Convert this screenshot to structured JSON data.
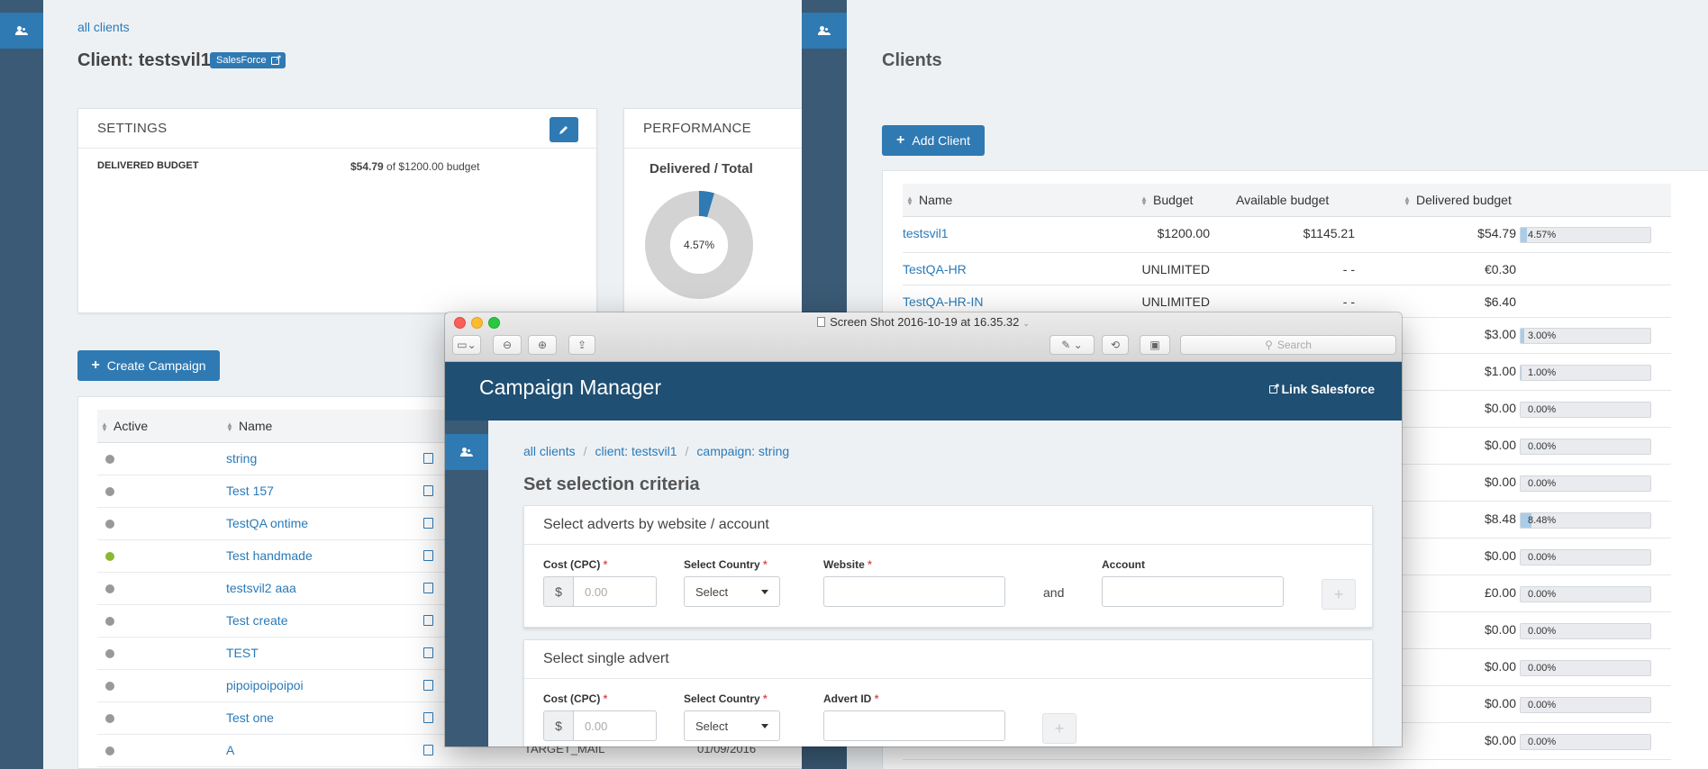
{
  "left_window": {
    "breadcrumb": "all clients",
    "title": "Client: testsvil1",
    "salesforce_badge": "SalesForce",
    "settings": {
      "heading": "SETTINGS",
      "delivered_budget_label": "DELIVERED BUDGET",
      "delivered_amount": "$54.79",
      "delivered_suffix": "of $1200.00 budget"
    },
    "performance": {
      "heading": "PERFORMANCE",
      "subtitle": "Delivered / Total",
      "percent_label": "4.57%",
      "fraction": 0.0457,
      "colors": {
        "delivered": "#2f7ab3",
        "remaining": "#d3d3d3"
      }
    },
    "create_campaign_label": "Create Campaign",
    "columns": {
      "active": "Active",
      "name": "Name"
    },
    "campaigns": [
      {
        "name": "string",
        "status_color": "#999999"
      },
      {
        "name": "Test 157",
        "status_color": "#999999"
      },
      {
        "name": "TestQA ontime",
        "status_color": "#999999"
      },
      {
        "name": "Test handmade",
        "status_color": "#8cb830"
      },
      {
        "name": "testsvil2 aaa",
        "status_color": "#999999"
      },
      {
        "name": "Test create",
        "status_color": "#999999"
      },
      {
        "name": "TEST",
        "status_color": "#999999"
      },
      {
        "name": "pipoipoipoipoi",
        "status_color": "#999999"
      },
      {
        "name": "Test one",
        "status_color": "#999999"
      },
      {
        "name": "A",
        "status_color": "#999999"
      }
    ],
    "partial_row": {
      "type": "TARGET_MAIL",
      "date": "01/09/2016"
    }
  },
  "right_window": {
    "title": "Clients",
    "add_client_label": "Add Client",
    "columns": {
      "name": "Name",
      "budget": "Budget",
      "available": "Available budget",
      "delivered": "Delivered budget"
    },
    "clients": [
      {
        "name": "testsvil1",
        "budget": "$1200.00",
        "available": "$1145.21",
        "delivered": "$54.79",
        "pct_label": "4.57%",
        "pct": 0.0457
      },
      {
        "name": "TestQA-HR",
        "budget": "UNLIMITED",
        "available": "- -",
        "delivered": "€0.30"
      },
      {
        "name": "TestQA-HR-IN",
        "budget": "UNLIMITED",
        "available": "- -",
        "delivered": "$6.40"
      },
      {
        "name": "",
        "delivered": "$3.00",
        "pct_label": "3.00%",
        "pct": 0.03
      },
      {
        "name": "",
        "delivered": "$1.00",
        "pct_label": "1.00%",
        "pct": 0.01
      },
      {
        "name": "",
        "delivered": "$0.00",
        "pct_label": "0.00%",
        "pct": 0
      },
      {
        "name": "",
        "delivered": "$0.00",
        "pct_label": "0.00%",
        "pct": 0
      },
      {
        "name": "",
        "delivered": "$0.00",
        "pct_label": "0.00%",
        "pct": 0
      },
      {
        "name": "",
        "delivered": "$8.48",
        "pct_label": "8.48%",
        "pct": 0.0848
      },
      {
        "name": "",
        "delivered": "$0.00",
        "pct_label": "0.00%",
        "pct": 0
      },
      {
        "name": "",
        "delivered": "£0.00",
        "pct_label": "0.00%",
        "pct": 0
      },
      {
        "name": "",
        "delivered": "$0.00",
        "pct_label": "0.00%",
        "pct": 0
      },
      {
        "name": "",
        "delivered": "$0.00",
        "pct_label": "0.00%",
        "pct": 0
      },
      {
        "name": "",
        "delivered": "$0.00",
        "pct_label": "0.00%",
        "pct": 0
      },
      {
        "name": "",
        "delivered": "$0.00",
        "pct_label": "0.00%",
        "pct": 0
      }
    ]
  },
  "preview_window": {
    "file_title": "Screen Shot 2016-10-19 at 16.35.32",
    "search_placeholder": "Search",
    "app": {
      "brand": "Campaign Manager",
      "link_salesforce": "Link Salesforce",
      "breadcrumb": [
        "all clients",
        "client: testsvil1",
        "campaign: string"
      ],
      "page_title": "Set selection criteria",
      "website_panel": {
        "heading": "Select adverts by website / account",
        "cost_label": "Cost (CPC)",
        "currency": "$",
        "cost_placeholder": "0.00",
        "country_label": "Select Country",
        "country_value": "Select",
        "website_label": "Website",
        "and_text": "and",
        "account_label": "Account",
        "add_symbol": "+"
      },
      "advert_panel": {
        "heading": "Select single advert",
        "cost_label": "Cost (CPC)",
        "currency": "$",
        "cost_placeholder": "0.00",
        "country_label": "Select Country",
        "country_value": "Select",
        "advert_label": "Advert ID",
        "add_symbol": "+"
      }
    }
  }
}
